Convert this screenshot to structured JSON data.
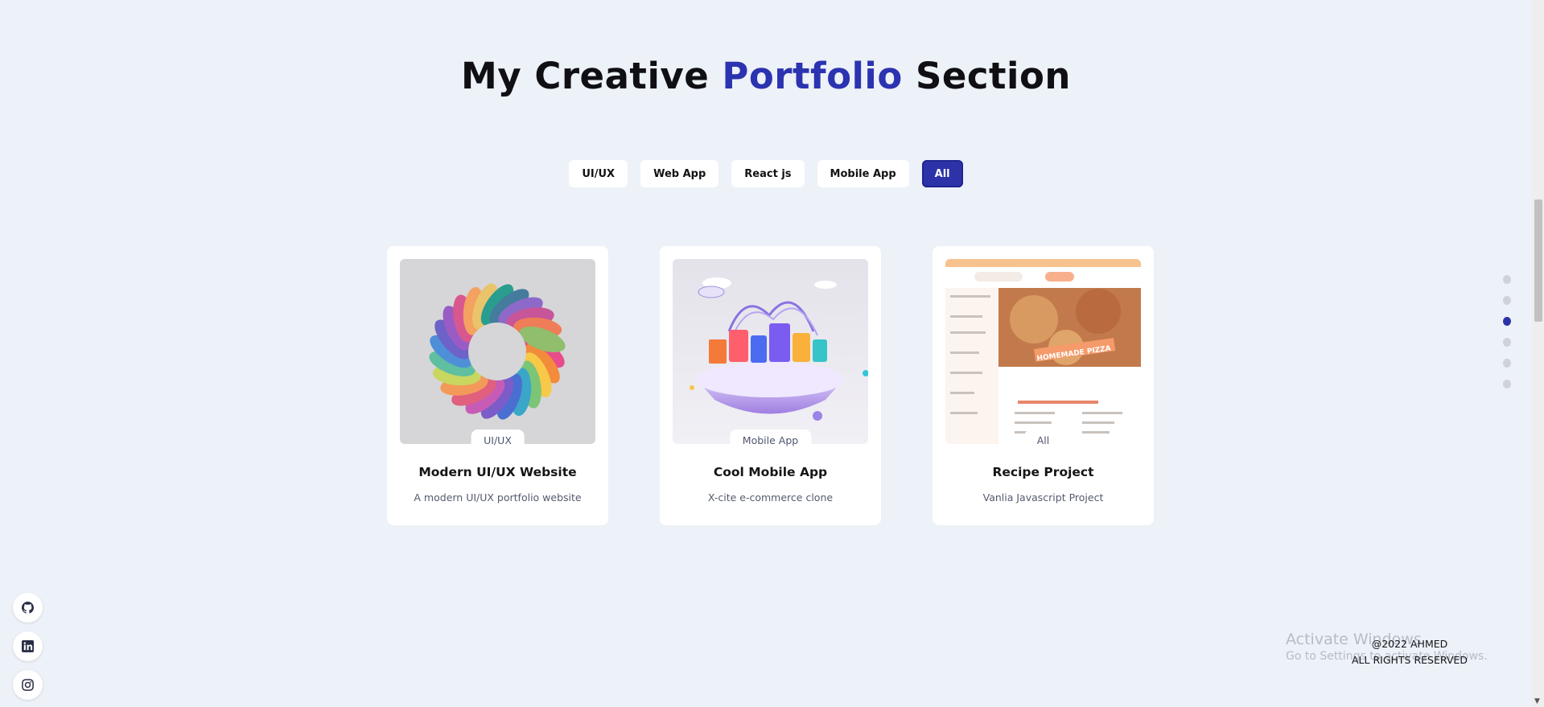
{
  "section": {
    "title_pre": "My Creative",
    "title_accent": "Portfolio",
    "title_post": "Section",
    "accent_color": "#2c33b0"
  },
  "filters": [
    {
      "label": "UI/UX",
      "active": false
    },
    {
      "label": "Web App",
      "active": false
    },
    {
      "label": "React js",
      "active": false
    },
    {
      "label": "Mobile App",
      "active": false
    },
    {
      "label": "All",
      "active": true
    }
  ],
  "cards": [
    {
      "tag": "UI/UX",
      "title": "Modern UI/UX Website",
      "subtitle": "A modern UI/UX portfolio website"
    },
    {
      "tag": "Mobile App",
      "title": "Cool Mobile App",
      "subtitle": "X-cite e-commerce clone"
    },
    {
      "tag": "All",
      "title": "Recipe Project",
      "subtitle": "Vanlia Javascript Project",
      "image_banner": "HOMEMADE PIZZA"
    }
  ],
  "social": [
    "github-icon",
    "linkedin-icon",
    "instagram-icon"
  ],
  "nav_dots": {
    "count": 6,
    "active_index": 2
  },
  "watermark": {
    "line1": "Activate Windows",
    "line2": "Go to Settings to activate Windows."
  },
  "footer": {
    "line1": "@2022 AHMED",
    "line2": "ALL RIGHTS RESERVED"
  }
}
